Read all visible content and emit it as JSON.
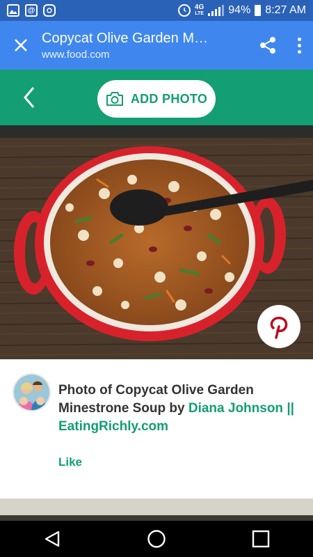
{
  "status_bar": {
    "net_top": "4G",
    "net_bottom": "LTE",
    "battery": "94%",
    "time": "8:27 AM"
  },
  "app_bar": {
    "title": "Copycat Olive Garden M…",
    "url": "www.food.com"
  },
  "header": {
    "add_photo_label": "ADD PHOTO"
  },
  "card": {
    "caption_prefix": "Photo of Copycat Olive Garden Minestrone Soup by ",
    "author": "Diana Johnson || EatingRichly.com",
    "like_label": "Like"
  },
  "colors": {
    "status_bar": "#2a62b8",
    "app_bar": "#3f87ee",
    "accent_green": "#139e73",
    "pot_red": "#d8222b",
    "pinterest_red": "#bd081c"
  },
  "icons": {
    "close": "close-icon",
    "share": "share-icon",
    "menu": "more-vert-icon",
    "back": "chevron-left-icon",
    "camera": "camera-icon",
    "pinterest": "pinterest-icon",
    "nav_back": "triangle-back-icon",
    "nav_home": "circle-home-icon",
    "nav_recents": "square-recents-icon"
  }
}
